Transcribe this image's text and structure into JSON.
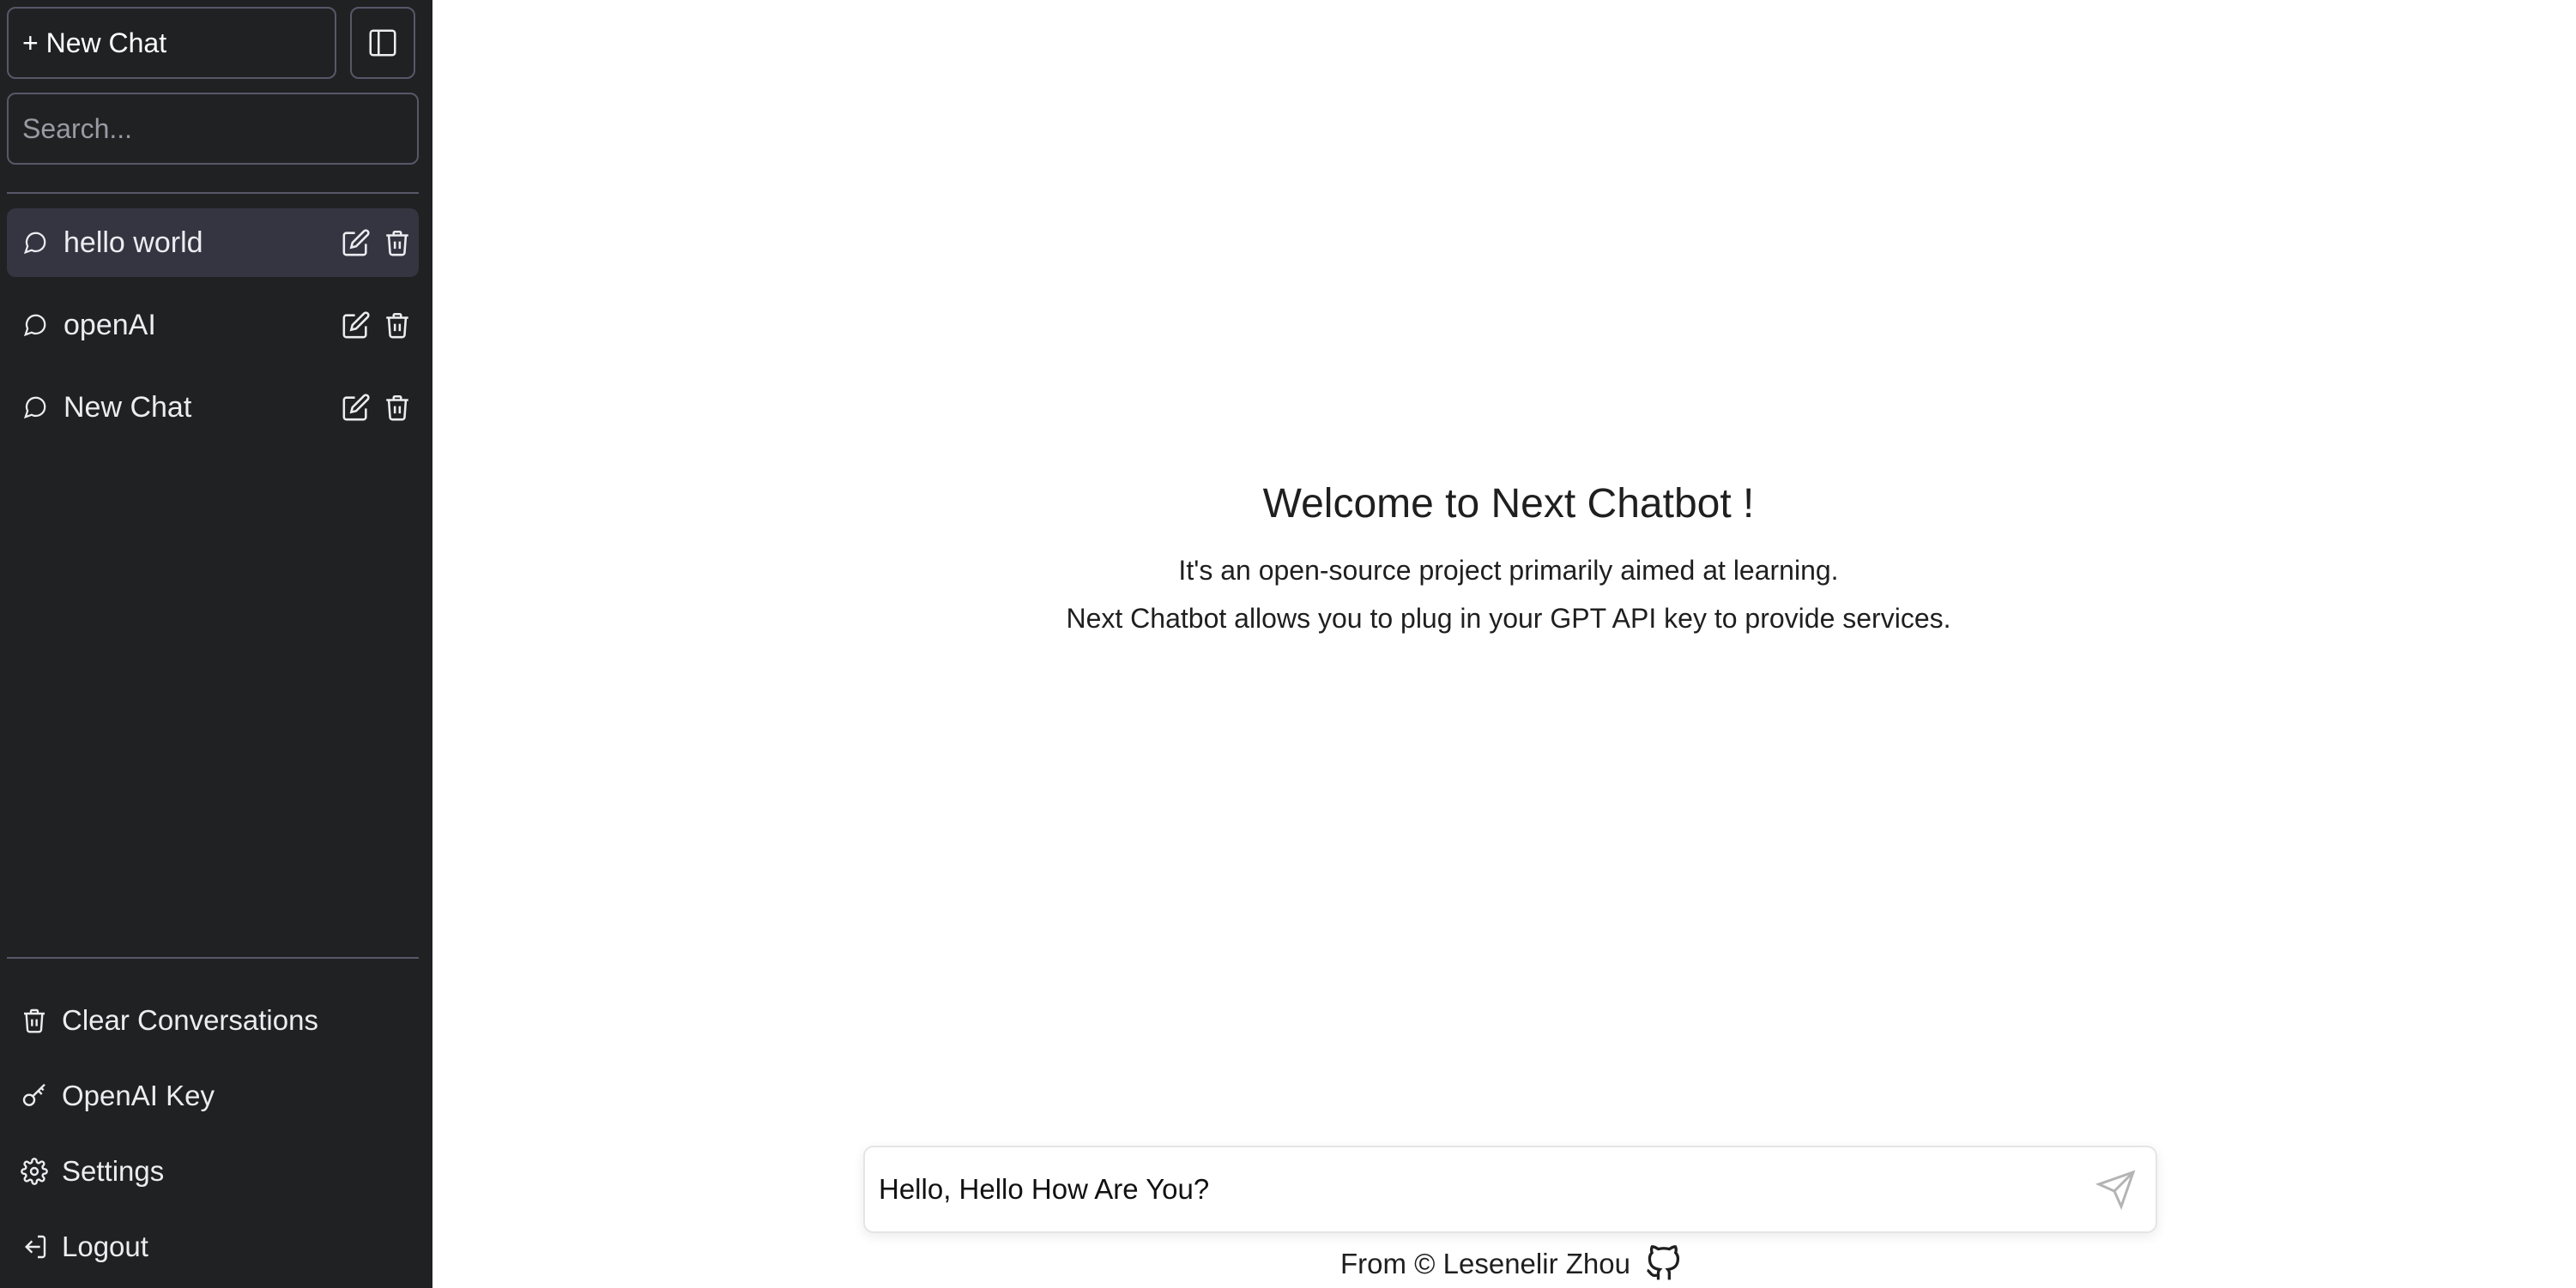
{
  "sidebar": {
    "new_chat_label": "+ New Chat",
    "search_placeholder": "Search...",
    "conversations": [
      {
        "title": "hello world",
        "active": true
      },
      {
        "title": "openAI",
        "active": false
      },
      {
        "title": "New Chat",
        "active": false
      }
    ],
    "bottom": {
      "clear": "Clear Conversations",
      "key": "OpenAI Key",
      "settings": "Settings",
      "logout": "Logout"
    }
  },
  "main": {
    "welcome_title": "Welcome to Next Chatbot !",
    "welcome_line1": "It's an open-source project primarily aimed at learning.",
    "welcome_line2": "Next Chatbot allows you to plug in your GPT API key to provide services.",
    "input_value": "Hello, Hello How Are You?",
    "footer_text": "From © Lesenelir Zhou"
  },
  "icons": {
    "sidebar_toggle": "panel-icon",
    "conversation": "message-circle-icon",
    "edit": "edit-icon",
    "delete": "trash-icon",
    "key": "key-icon",
    "settings": "gear-icon",
    "logout": "logout-icon",
    "send": "send-icon",
    "github": "github-icon"
  },
  "colors": {
    "sidebar_bg": "#202123",
    "active_item_bg": "#343541",
    "border": "#565869"
  }
}
